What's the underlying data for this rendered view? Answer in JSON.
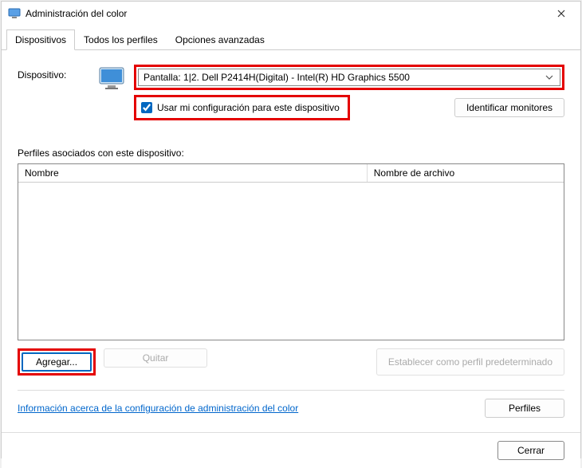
{
  "titlebar": {
    "title": "Administración del color"
  },
  "tabs": [
    {
      "label": "Dispositivos",
      "active": true
    },
    {
      "label": "Todos los perfiles",
      "active": false
    },
    {
      "label": "Opciones avanzadas",
      "active": false
    }
  ],
  "device": {
    "label": "Dispositivo:",
    "selected": "Pantalla: 1|2. Dell P2414H(Digital) - Intel(R) HD Graphics 5500",
    "use_my_settings": "Usar mi configuración para este dispositivo",
    "identify_monitors": "Identificar monitores"
  },
  "profiles": {
    "section_label": "Perfiles asociados con este dispositivo:",
    "col_name": "Nombre",
    "col_file": "Nombre de archivo",
    "rows": []
  },
  "buttons": {
    "add": "Agregar...",
    "remove": "Quitar",
    "set_default": "Establecer como perfil predeterminado",
    "profiles_menu": "Perfiles",
    "close": "Cerrar"
  },
  "help_link": "Información acerca de la configuración de administración del color",
  "colors": {
    "highlight": "#e40000",
    "accent": "#0067c0"
  }
}
